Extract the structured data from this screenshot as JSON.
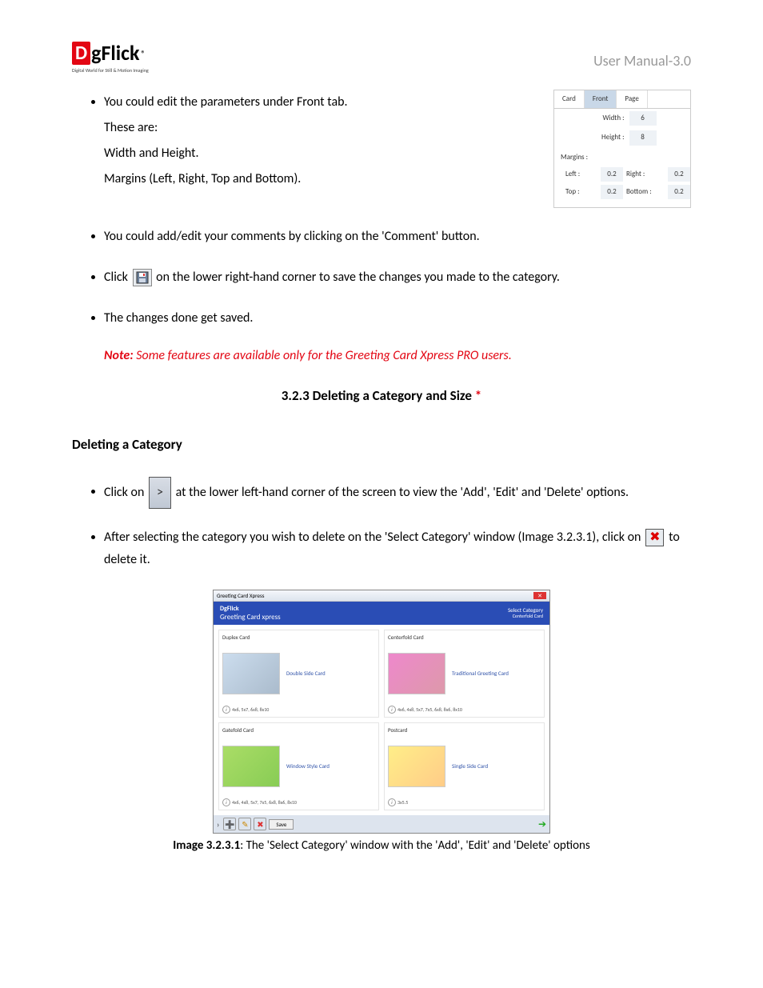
{
  "header": {
    "logo_d": "D",
    "logo_rest": "gFlick",
    "logo_reg": "®",
    "logo_tagline": "Digital World for Still & Motion Imaging",
    "manual": "User Manual-3.0"
  },
  "bullets": {
    "b1_l1": "You could edit the parameters under Front tab.",
    "b1_l2": "These are:",
    "b1_l3": "Width and Height.",
    "b1_l4": "Margins (Left, Right, Top and Bottom).",
    "b2": "You could add/edit your comments by clicking on the 'Comment' button.",
    "b3_pre": "Click",
    "b3_post": "on the lower right-hand corner to save the changes you made to the category.",
    "b4": "The changes done get saved.",
    "b5_pre": "Click on",
    "b5_post": "at the lower left-hand corner of the screen to view the 'Add', 'Edit' and 'Delete' options.",
    "b6_pre": "After selecting the category you wish to delete on the 'Select Category' window (Image 3.2.3.1), click on",
    "b6_post": "to delete it."
  },
  "panel": {
    "tab_card": "Card",
    "tab_front": "Front",
    "tab_page": "Page",
    "width_lbl": "Width :",
    "width_val": "6",
    "height_lbl": "Height :",
    "height_val": "8",
    "margins_lbl": "Margins :",
    "left_lbl": "Left :",
    "left_val": "0.2",
    "right_lbl": "Right :",
    "right_val": "0.2",
    "top_lbl": "Top :",
    "top_val": "0.2",
    "bottom_lbl": "Bottom :",
    "bottom_val": "0.2"
  },
  "note": {
    "label": "Note:",
    "text": " Some features are available only for the Greeting Card Xpress PRO users."
  },
  "section": {
    "num_title": "3.2.3    Deleting a Category and Size ",
    "ast": "*",
    "sub": "Deleting a Category"
  },
  "screenshot": {
    "window_title": "Greeting Card Xpress",
    "app_title": "Greeting Card xpress",
    "top_right1": "Select Category",
    "top_right2": "Centerfold Card",
    "cats": [
      {
        "title": "Duplex Card",
        "style": "Double Side Card",
        "sizes": "4x6, 5x7, 6x8, 8x10",
        "thumb": "blue"
      },
      {
        "title": "Centerfold Card",
        "style": "Traditional Greeting Card",
        "sizes": "4x6, 4x8, 5x7, 7x5, 6x8, 8x6, 8x10",
        "thumb": "pink"
      },
      {
        "title": "Gatefold Card",
        "style": "Window Style Card",
        "sizes": "4x6, 4x8, 5x7, 7x5, 6x8, 8x6, 8x10",
        "thumb": "green"
      },
      {
        "title": "Postcard",
        "style": "Single Side Card",
        "sizes": "3x5.5",
        "thumb": "yellow"
      }
    ],
    "footer_save": "Save"
  },
  "caption": {
    "bold": "Image 3.2.3.1",
    "rest": ": The 'Select Category' window with the 'Add', 'Edit' and 'Delete' options"
  }
}
